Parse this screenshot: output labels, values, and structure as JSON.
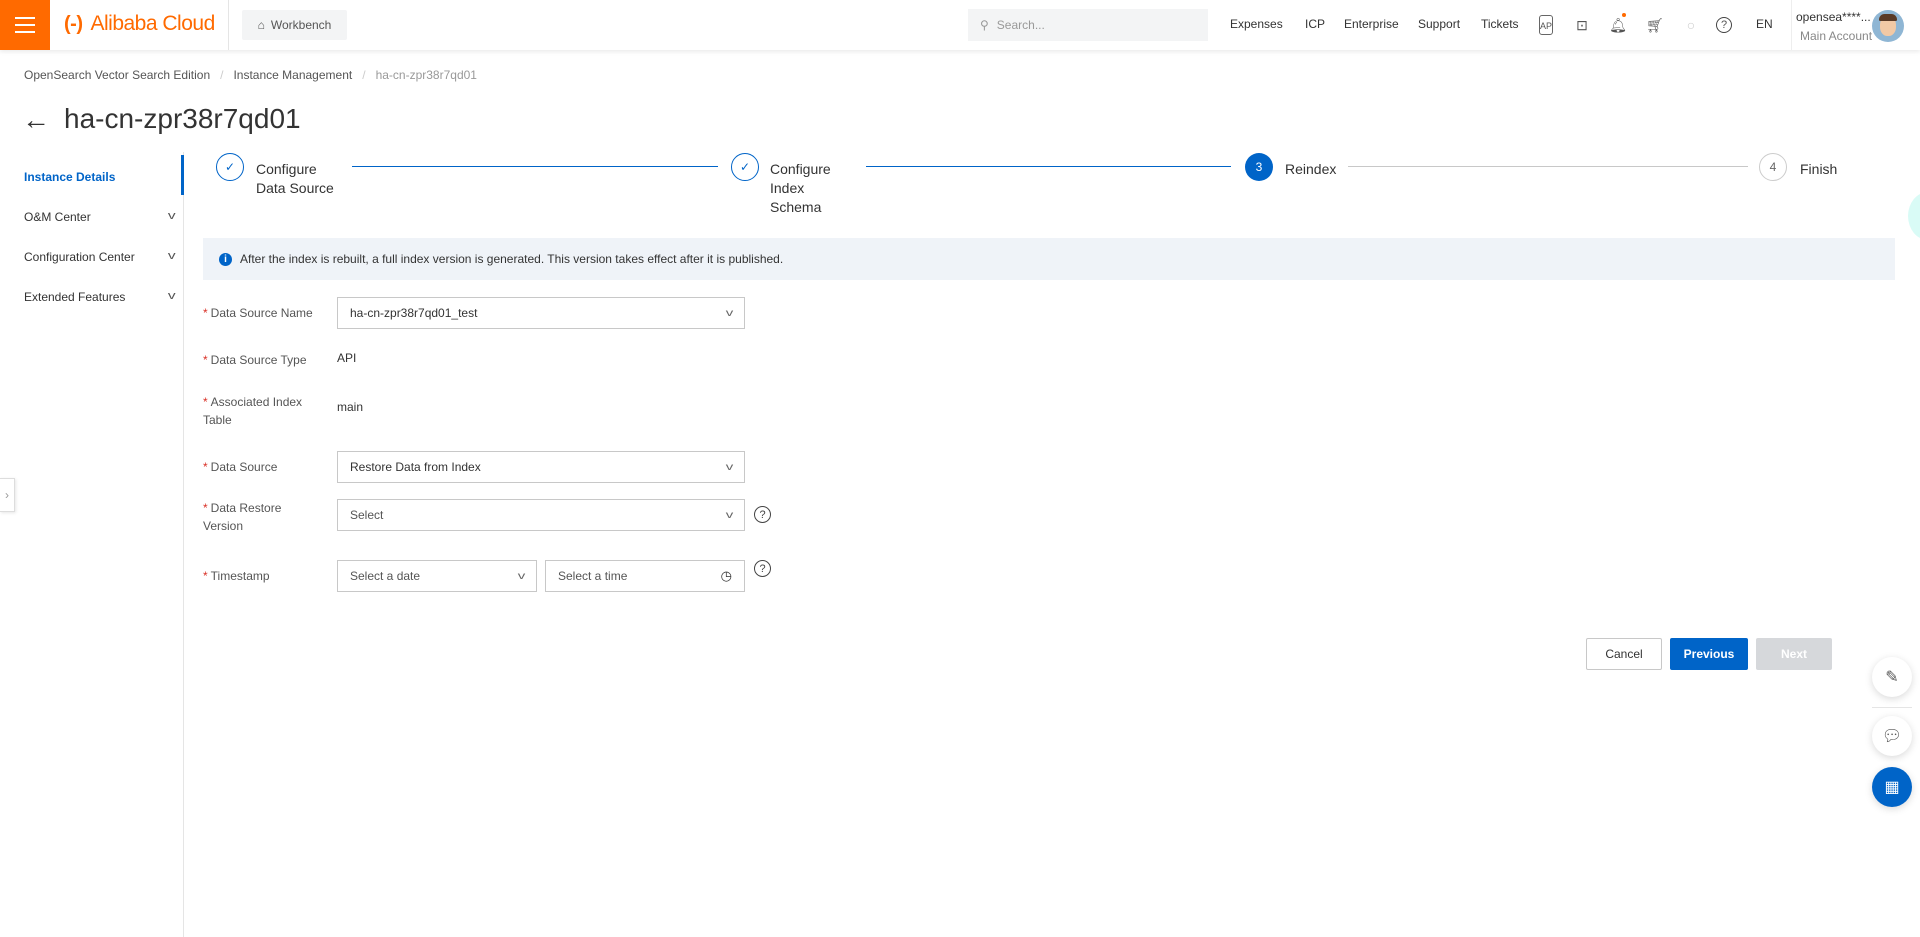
{
  "header": {
    "logo": "Alibaba Cloud",
    "workbench": "Workbench",
    "search_placeholder": "Search...",
    "nav": [
      "Expenses",
      "ICP",
      "Enterprise",
      "Support",
      "Tickets"
    ],
    "icons": [
      "app-icon",
      "terminal-icon",
      "bell-icon",
      "cart-icon",
      "lightbulb-icon",
      "help-icon"
    ],
    "lang": "EN",
    "user_name": "opensea****...",
    "user_account": "Main Account",
    "brand_color": "#ff6a00"
  },
  "breadcrumb": [
    "OpenSearch Vector Search Edition",
    "Instance Management",
    "ha-cn-zpr38r7qd01"
  ],
  "page_title": "ha-cn-zpr38r7qd01",
  "sidebar": {
    "items": [
      {
        "label": "Instance Details",
        "active": true
      },
      {
        "label": "O&M Center"
      },
      {
        "label": "Configuration Center"
      },
      {
        "label": "Extended Features"
      }
    ]
  },
  "steps": [
    {
      "num": "1",
      "label": "Configure Data Source",
      "status": "done"
    },
    {
      "num": "2",
      "label": "Configure Index Schema",
      "status": "done"
    },
    {
      "num": "3",
      "label": "Reindex",
      "status": "current"
    },
    {
      "num": "4",
      "label": "Finish",
      "status": "todo"
    }
  ],
  "alert": "After the index is rebuilt, a full index version is generated. This version takes effect after it is published.",
  "form": {
    "data_source_name": {
      "label": "Data Source Name",
      "value": "ha-cn-zpr38r7qd01_test"
    },
    "data_source_type": {
      "label": "Data Source Type",
      "value": "API"
    },
    "associated_index_table": {
      "label": "Associated Index Table",
      "value": "main"
    },
    "data_source": {
      "label": "Data Source",
      "value": "Restore Data from Index"
    },
    "data_restore_version": {
      "label": "Data Restore Version",
      "placeholder": "Select"
    },
    "timestamp": {
      "label": "Timestamp",
      "date_placeholder": "Select a date",
      "time_placeholder": "Select a time"
    }
  },
  "buttons": {
    "cancel": "Cancel",
    "previous": "Previous",
    "next": "Next"
  },
  "accent": "#0064c8"
}
